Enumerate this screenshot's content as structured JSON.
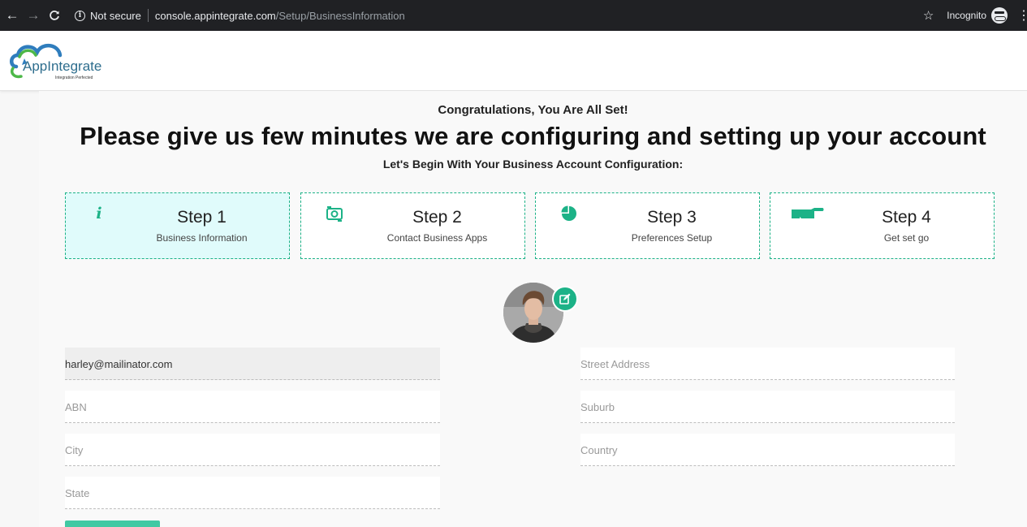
{
  "browser": {
    "back_glyph": "←",
    "forward_glyph": "→",
    "reload_glyph": "C",
    "security_label": "Not secure",
    "url_host": "console.appintegrate.com",
    "url_path": "/Setup/BusinessInformation",
    "star_glyph": "☆",
    "incognito_label": "Incognito",
    "menu_glyph": "⋮"
  },
  "brand": {
    "name": "AppIntegrate",
    "tagline": "Integration Perfected"
  },
  "hero": {
    "congrats": "Congratulations, You Are All Set!",
    "headline": "Please give us few minutes we are configuring and setting up your account",
    "subhead": "Let's Begin With Your Business Account Configuration:"
  },
  "steps": [
    {
      "title": "Step 1",
      "subtitle": "Business Information",
      "icon": "info-icon",
      "active": true
    },
    {
      "title": "Step 2",
      "subtitle": "Contact Business Apps",
      "icon": "sync-camera-icon",
      "active": false
    },
    {
      "title": "Step 3",
      "subtitle": "Preferences Setup",
      "icon": "pie-chart-icon",
      "active": false
    },
    {
      "title": "Step 4",
      "subtitle": "Get set go",
      "icon": "hand-pointer-icon",
      "active": false
    }
  ],
  "form": {
    "email": {
      "value": "harley@mailinator.com",
      "placeholder": ""
    },
    "abn": {
      "value": "",
      "placeholder": "ABN"
    },
    "city": {
      "value": "",
      "placeholder": "City"
    },
    "state": {
      "value": "",
      "placeholder": "State"
    },
    "street": {
      "value": "",
      "placeholder": "Street Address"
    },
    "suburb": {
      "value": "",
      "placeholder": "Suburb"
    },
    "country": {
      "value": "",
      "placeholder": "Country"
    }
  },
  "colors": {
    "accent": "#1cb287",
    "active_step_bg": "#e0fbfb",
    "chrome_bg": "#202124"
  }
}
